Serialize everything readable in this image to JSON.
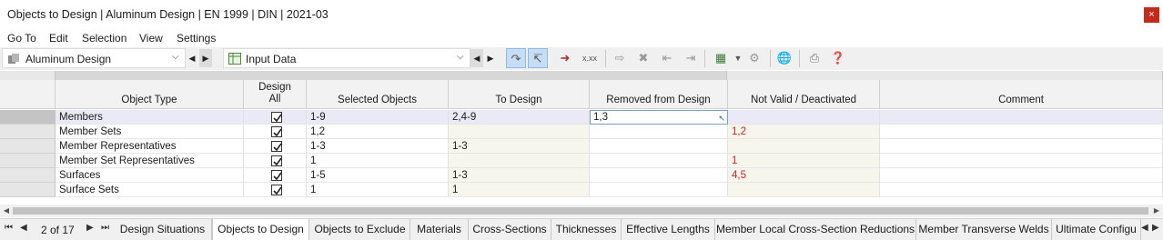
{
  "window": {
    "title": "Objects to Design | Aluminum Design | EN 1999 | DIN | 2021-03",
    "close_label": "×"
  },
  "menu": [
    "Go To",
    "Edit",
    "Selection",
    "View",
    "Settings"
  ],
  "toolbar": {
    "module_combo": "Aluminum Design",
    "table_combo": "Input Data"
  },
  "table": {
    "headers": {
      "object_type": "Object Type",
      "design_all_1": "Design",
      "design_all_2": "All",
      "selected": "Selected Objects",
      "to_design": "To Design",
      "removed": "Removed from Design",
      "not_valid": "Not Valid / Deactivated",
      "comment": "Comment"
    },
    "rows": [
      {
        "type": "Members",
        "selected": "1-9",
        "to_design": "2,4-9",
        "removed": "1,3",
        "not_valid": "",
        "comment": ""
      },
      {
        "type": "Member Sets",
        "selected": "1,2",
        "to_design": "",
        "removed": "",
        "not_valid": "1,2",
        "comment": ""
      },
      {
        "type": "Member Representatives",
        "selected": "1-3",
        "to_design": "1-3",
        "removed": "",
        "not_valid": "",
        "comment": ""
      },
      {
        "type": "Member Set Representatives",
        "selected": "1",
        "to_design": "",
        "removed": "",
        "not_valid": "1",
        "comment": ""
      },
      {
        "type": "Surfaces",
        "selected": "1-5",
        "to_design": "1-3",
        "removed": "",
        "not_valid": "4,5",
        "comment": ""
      },
      {
        "type": "Surface Sets",
        "selected": "1",
        "to_design": "1",
        "removed": "",
        "not_valid": "",
        "comment": ""
      }
    ]
  },
  "pager": {
    "text": "2 of 17"
  },
  "tabs": [
    "Design Situations",
    "Objects to Design",
    "Objects to Exclude",
    "Materials",
    "Cross-Sections",
    "Thicknesses",
    "Effective Lengths",
    "Member Local Cross-Section Reductions",
    "Member Transverse Welds",
    "Ultimate Configu"
  ],
  "colors": {
    "accent_red": "#d22222",
    "selected_row": "#e9eaf6",
    "readonly_cell": "#f6f6ed"
  }
}
